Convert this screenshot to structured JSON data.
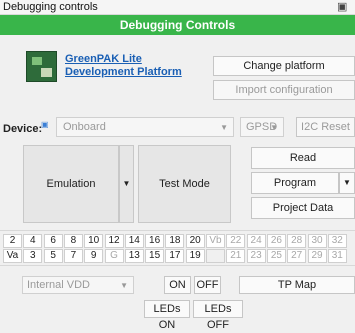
{
  "window": {
    "title": "Debugging controls"
  },
  "header": {
    "title": "Debugging Controls"
  },
  "platform": {
    "link": "GreenPAK Lite Development Platform"
  },
  "buttons": {
    "change_platform": "Change platform",
    "import_configuration": "Import configuration",
    "i2c_reset": "I2C Reset",
    "emulation": "Emulation",
    "test_mode": "Test Mode",
    "read": "Read",
    "program": "Program",
    "project_data": "Project Data",
    "on": "ON",
    "off": "OFF",
    "tp_map": "TP Map",
    "leds_on": "LEDs ON",
    "leds_off": "LEDs OFF"
  },
  "device": {
    "label": "Device:",
    "value": "Onboard",
    "gpsd": "GPSD"
  },
  "power": {
    "value": "Internal VDD"
  },
  "pins": {
    "row1": [
      "2",
      "4",
      "6",
      "8",
      "10",
      "12",
      "14",
      "16",
      "18",
      "20",
      "Vb",
      "22",
      "24",
      "26",
      "28",
      "30",
      "32"
    ],
    "row2": [
      "Va",
      "3",
      "5",
      "7",
      "9",
      "G",
      "13",
      "15",
      "17",
      "19",
      "",
      "21",
      "23",
      "25",
      "27",
      "29",
      "31"
    ]
  }
}
